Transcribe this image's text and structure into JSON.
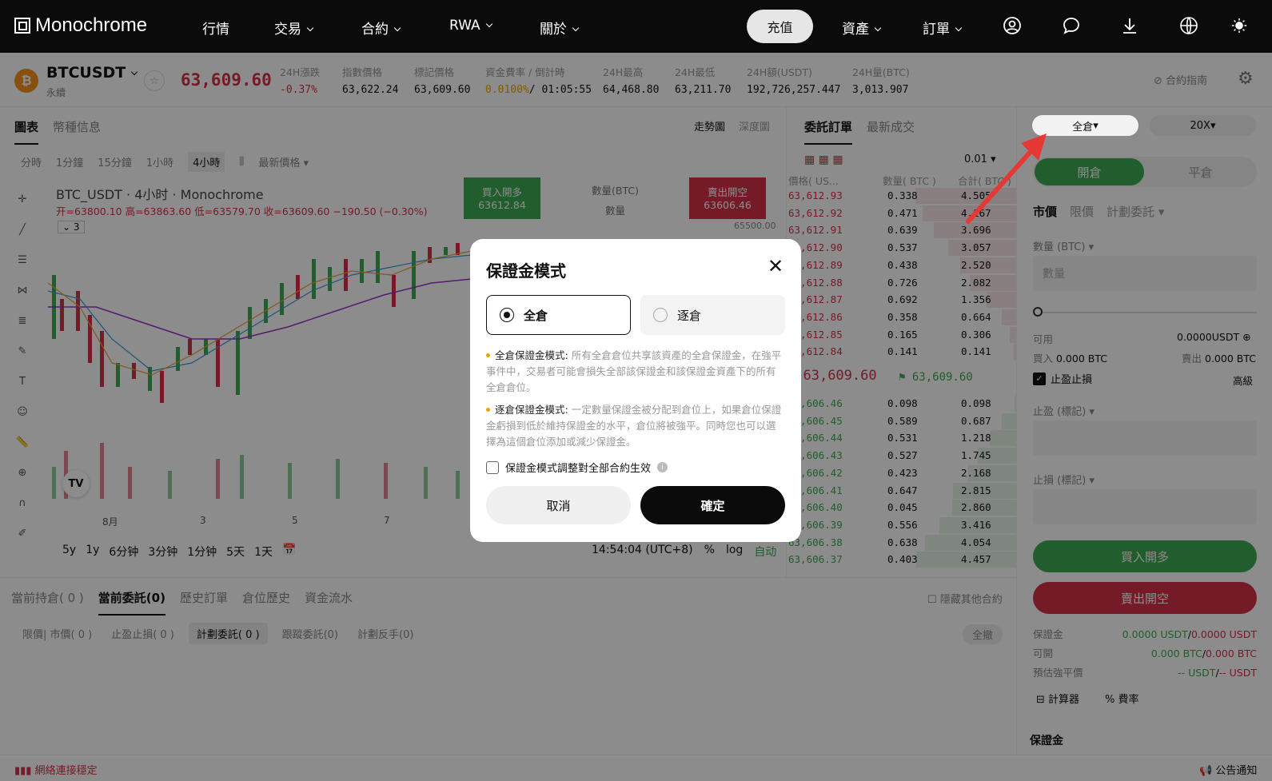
{
  "nav": {
    "logo": "Monochrome",
    "items": [
      "行情",
      "交易",
      "合約",
      "RWA",
      "關於"
    ],
    "deposit": "充值",
    "assets": "資產",
    "orders": "訂單"
  },
  "ticker": {
    "symbol": "BTCUSDT",
    "sub": "永續",
    "price": "63,609.60",
    "change_label": "24H漲跌",
    "change_val": "-0.37%",
    "index_label": "指數價格",
    "index_val": "63,622.24",
    "mark_label": "標記價格",
    "mark_val": "63,609.60",
    "funding_label": "資金費率 / 倒計時",
    "funding_rate": "0.0100%",
    "funding_time": "/ 01:05:55",
    "high_label": "24H最高",
    "high_val": "64,468.80",
    "low_label": "24H最低",
    "low_val": "63,211.70",
    "amt_label": "24H額(USDT)",
    "amt_val": "192,726,257.447",
    "vol_label": "24H量(BTC)",
    "vol_val": "3,013.907",
    "guide": "合約指南"
  },
  "chart": {
    "tab_chart": "圖表",
    "tab_info": "幣種信息",
    "view_trend": "走勢圖",
    "view_depth": "深度圖",
    "intervals": [
      "分時",
      "1分鐘",
      "15分鐘",
      "1小時",
      "4小時"
    ],
    "price_type": "最新價格",
    "title": "BTC_USDT · 4小时 · Monochrome",
    "ohlc": "开=63800.10 高=63863.60 低=63579.70 收=63609.60 −190.50 (−0.30%)",
    "indicator_count": "3",
    "buy_label": "買入開多",
    "buy_price": "63612.84",
    "qty_label": "數量(BTC)",
    "qty_placeholder": "數量",
    "sell_label": "賣出開空",
    "sell_price": "63606.46",
    "axis_top": "65500.00",
    "xaxis": [
      "8月",
      "3",
      "5",
      "7"
    ],
    "ranges": [
      "5y",
      "1y",
      "6分钟",
      "3分钟",
      "1分钟",
      "5天",
      "1天"
    ],
    "time": "14:54:04 (UTC+8)",
    "pct": "%",
    "log": "log",
    "auto": "自动"
  },
  "orderbook": {
    "tab_active": "委託訂單",
    "tab_trades": "最新成交",
    "precision": "0.01",
    "col_price": "價格( US...",
    "col_qty": "數量( BTC )",
    "col_total": "合計( BTC )",
    "asks": [
      [
        "63,612.93",
        "0.338",
        "4.505"
      ],
      [
        "63,612.92",
        "0.471",
        "4.167"
      ],
      [
        "63,612.91",
        "0.639",
        "3.696"
      ],
      [
        "63,612.90",
        "0.537",
        "3.057"
      ],
      [
        "63,612.89",
        "0.438",
        "2.520"
      ],
      [
        "63,612.88",
        "0.726",
        "2.082"
      ],
      [
        "63,612.87",
        "0.692",
        "1.356"
      ],
      [
        "63,612.86",
        "0.358",
        "0.664"
      ],
      [
        "63,612.85",
        "0.165",
        "0.306"
      ],
      [
        "63,612.84",
        "0.141",
        "0.141"
      ]
    ],
    "last_price": "63,609.60",
    "mark_price": "63,609.60",
    "bids": [
      [
        "63,606.46",
        "0.098",
        "0.098"
      ],
      [
        "63,606.45",
        "0.589",
        "0.687"
      ],
      [
        "63,606.44",
        "0.531",
        "1.218"
      ],
      [
        "63,606.43",
        "0.527",
        "1.745"
      ],
      [
        "63,606.42",
        "0.423",
        "2.168"
      ],
      [
        "63,606.41",
        "0.647",
        "2.815"
      ],
      [
        "63,606.40",
        "0.045",
        "2.860"
      ],
      [
        "63,606.39",
        "0.556",
        "3.416"
      ],
      [
        "63,606.38",
        "0.638",
        "4.054"
      ],
      [
        "63,606.37",
        "0.403",
        "4.457"
      ]
    ]
  },
  "trade": {
    "margin_mode": "全倉",
    "leverage": "20X",
    "open": "開倉",
    "close": "平倉",
    "types": [
      "市價",
      "限價",
      "計劃委託"
    ],
    "qty_label": "數量 (BTC)",
    "qty_placeholder": "數量",
    "avail_label": "可用",
    "avail_val": "0.0000USDT",
    "buy_label": "買入",
    "buy_val": "0.000 BTC",
    "sell_label": "賣出",
    "sell_val": "0.000 BTC",
    "tpsl": "止盈止損",
    "advanced": "高級",
    "tp_label": "止盈 (標記)",
    "sl_label": "止損 (標記)",
    "buy_btn": "買入開多",
    "sell_btn": "賣出開空",
    "margin_label": "保證金",
    "margin_val": "0.0000 USDT",
    "margin_val2": "0.0000 USDT",
    "avail2_label": "可開",
    "avail2_val": "0.000 BTC",
    "avail2_val2": "0.000 BTC",
    "liq_label": "預估強平價",
    "liq_val": "-- USDT",
    "liq_val2": "-- USDT",
    "calc": "計算器",
    "rate": "費率",
    "bottom_label": "保證金"
  },
  "bottom": {
    "tabs": [
      "當前持倉( 0 )",
      "當前委託(0)",
      "歷史訂單",
      "倉位歷史",
      "資金流水"
    ],
    "hide_others": "隱藏其他合約",
    "subtabs": [
      "限價| 市價( 0 )",
      "止盈止損( 0 )",
      "計劃委託( 0 )",
      "跟蹤委託(0)",
      "計劃反手(0)"
    ],
    "cancel_all": "全撤"
  },
  "status": {
    "connection": "網絡連接穩定",
    "announce": "公告通知"
  },
  "modal": {
    "title": "保證金模式",
    "opt_cross": "全倉",
    "opt_isolated": "逐倉",
    "cross_title": "全倉保證金模式:",
    "cross_desc": "所有全倉倉位共享該資產的全倉保證金，在強平事件中，交易者可能會損失全部該保證金和該保證金資產下的所有全倉倉位。",
    "iso_title": "逐倉保證金模式:",
    "iso_desc": "一定數量保證金被分配到倉位上，如果倉位保證金虧損到低於維持保證金的水平，倉位將被強平。同時您也可以選擇為這個倉位添加或減少保證金。",
    "apply_all": "保證金模式調整對全部合約生效",
    "cancel": "取消",
    "confirm": "確定"
  },
  "colors": {
    "up": "#3daa52",
    "down": "#d6324a",
    "accent": "#f0a100"
  }
}
